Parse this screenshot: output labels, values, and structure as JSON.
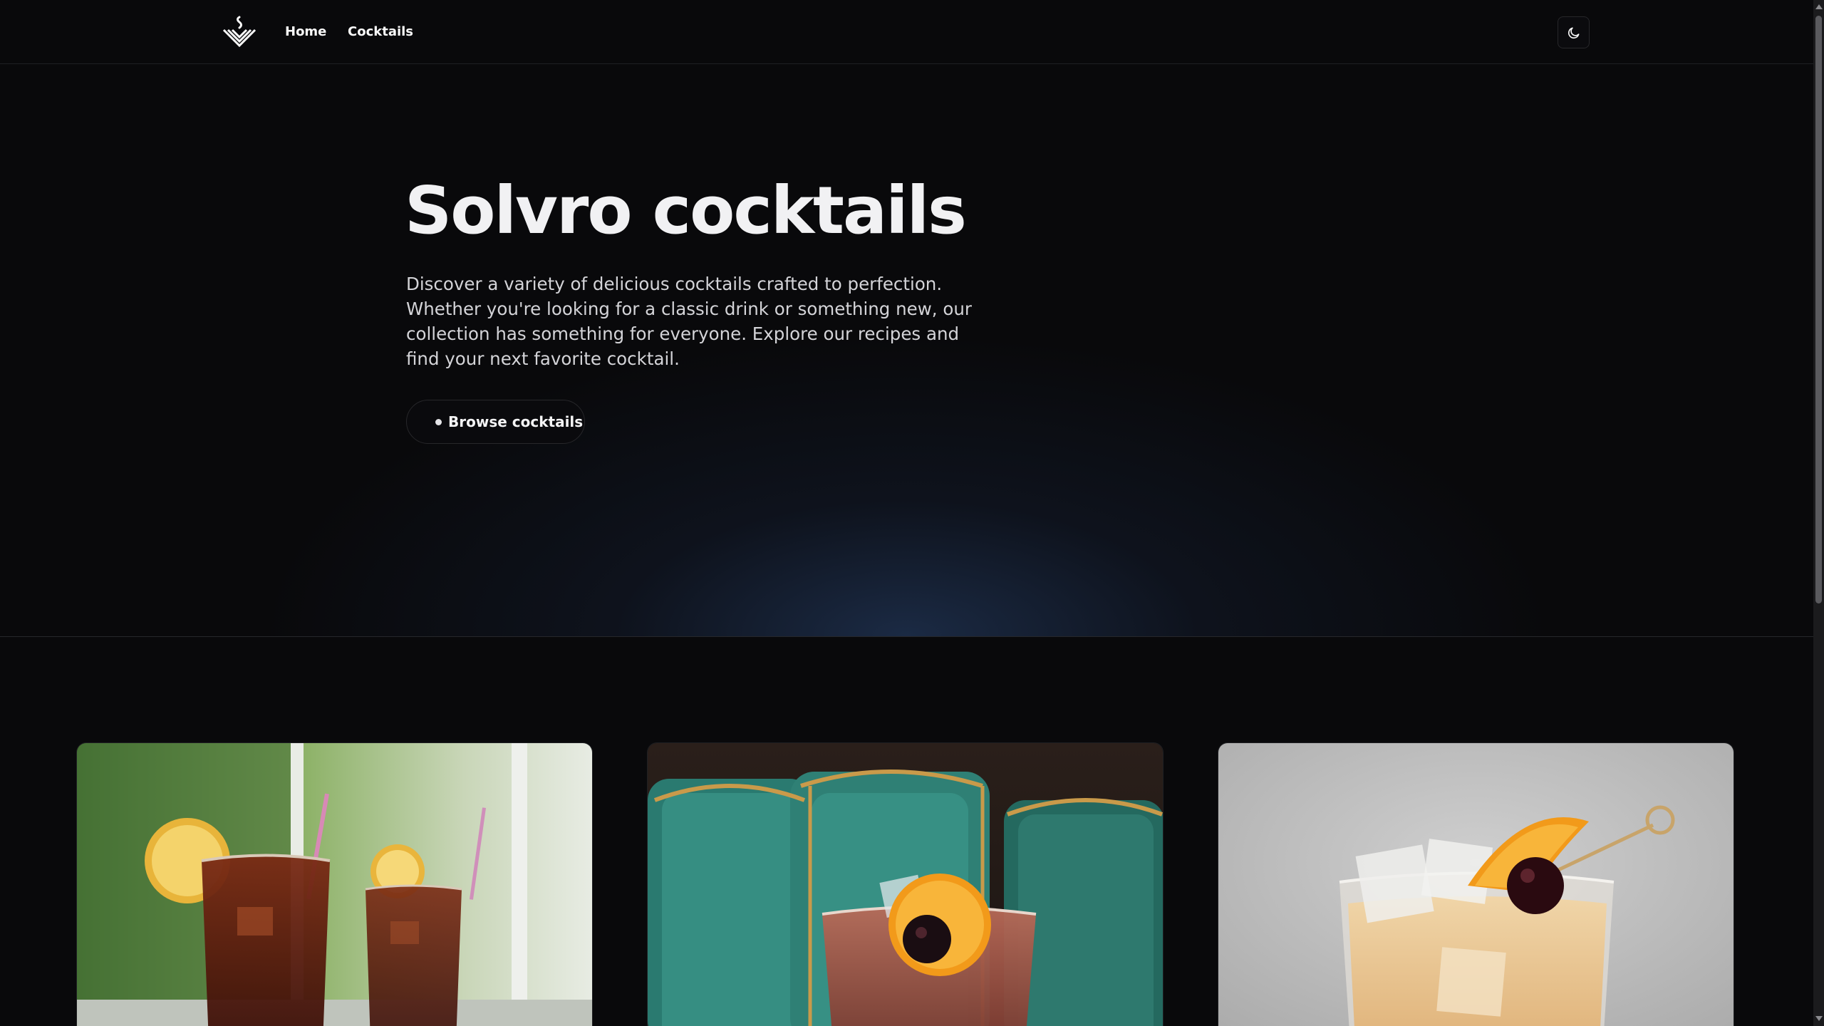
{
  "header": {
    "logo_icon": "solvro-logo-icon",
    "nav": [
      {
        "label": "Home"
      },
      {
        "label": "Cocktails"
      }
    ],
    "theme_toggle_icon": "moon-icon"
  },
  "hero": {
    "title": "Solvro cocktails",
    "description": "Discover a variety of delicious cocktails crafted to perfection. Whether you're looking for a classic drink or something new, our collection has something for everyone. Explore our recipes and find your next favorite cocktail.",
    "cta_label": "Browse cocktails"
  },
  "cocktails": [
    {
      "image": "cocktail-iced-tea-lemon-photo"
    },
    {
      "image": "cocktail-old-fashioned-orange-cherry-photo"
    },
    {
      "image": "cocktail-whiskey-sour-orange-cherry-photo"
    }
  ],
  "colors": {
    "background": "#09090b",
    "border": "#27272a",
    "text": "#fafafa",
    "muted_text": "#d4d4d8",
    "hero_glow": "#1e304e"
  }
}
